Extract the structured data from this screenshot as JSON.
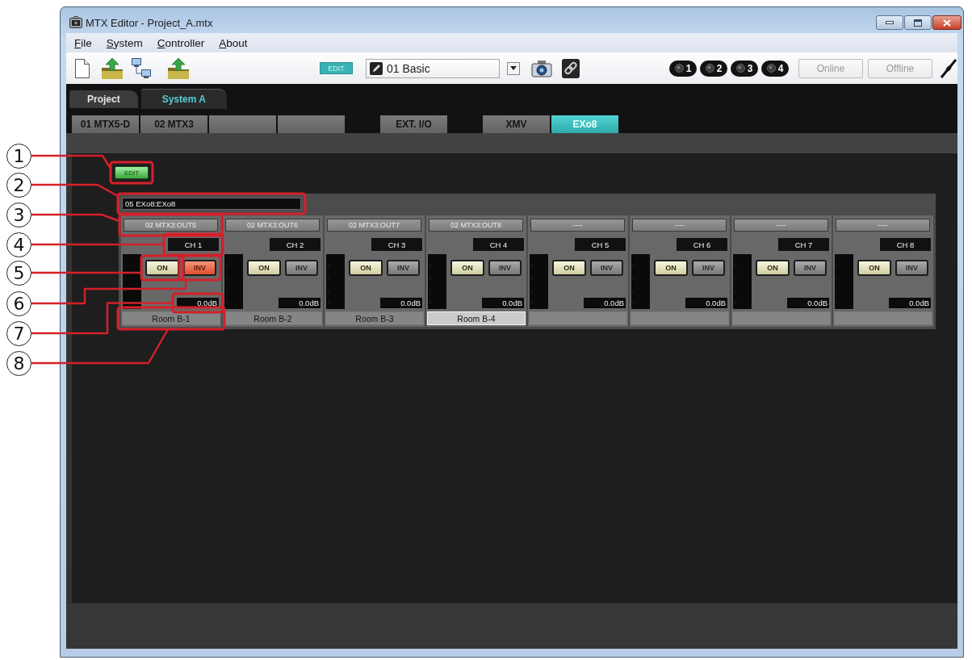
{
  "window": {
    "title": "MTX Editor - Project_A.mtx"
  },
  "menu": [
    "File",
    "System",
    "Controller",
    "About"
  ],
  "toolbar": {
    "mode": "EDIT",
    "preset": "01 Basic",
    "units": [
      "1",
      "2",
      "3",
      "4"
    ],
    "buttons": [
      {
        "label": "Online",
        "disabled": true
      },
      {
        "label": "Offline",
        "disabled": true
      }
    ]
  },
  "tabs": [
    {
      "label": "Project",
      "selected": false
    },
    {
      "label": "System A",
      "selected": true
    }
  ],
  "device_groups": [
    [
      {
        "label": "01 MTX5-D",
        "selected": false
      },
      {
        "label": "02 MTX3",
        "selected": false
      },
      {
        "selected": false
      },
      {
        "selected": false
      }
    ],
    [
      {
        "label": "EXT. I/O",
        "selected": false
      }
    ],
    [
      {
        "label": "XMV",
        "selected": false
      },
      {
        "label": "EXo8",
        "selected": true
      }
    ]
  ],
  "edit_button": "EDIT",
  "device_name": "05 EXo8:EXo8",
  "channels": [
    {
      "source": "02 MTX3:OUT5",
      "name": "CH 1",
      "on_button": {
        "label": "ON",
        "on": true
      },
      "inv_button": {
        "label": "INV",
        "on": true
      },
      "reading": "0.0dB",
      "room": "Room B-1",
      "room_selected": false
    },
    {
      "source": "02 MTX3:OUT6",
      "name": "CH 2",
      "on_button": {
        "label": "ON",
        "on": true
      },
      "inv_button": {
        "label": "INV",
        "on": false
      },
      "reading": "0.0dB",
      "room": "Room B-2",
      "room_selected": false
    },
    {
      "source": "02 MTX3:OUT7",
      "name": "CH 3",
      "on_button": {
        "label": "ON",
        "on": true
      },
      "inv_button": {
        "label": "INV",
        "on": false
      },
      "reading": "0.0dB",
      "room": "Room B-3",
      "room_selected": false
    },
    {
      "source": "02 MTX3:OUT8",
      "name": "CH 4",
      "on_button": {
        "label": "ON",
        "on": true
      },
      "inv_button": {
        "label": "INV",
        "on": false
      },
      "reading": "0.0dB",
      "room": "Room B-4",
      "room_selected": true
    },
    {
      "source": "----",
      "name": "CH 5",
      "on_button": {
        "label": "ON",
        "on": true
      },
      "inv_button": {
        "label": "INV",
        "on": false
      },
      "reading": "0.0dB",
      "room_selected": false
    },
    {
      "source": "----",
      "name": "CH 6",
      "on_button": {
        "label": "ON",
        "on": true
      },
      "inv_button": {
        "label": "INV",
        "on": false
      },
      "reading": "0.0dB",
      "room_selected": false
    },
    {
      "source": "----",
      "name": "CH 7",
      "on_button": {
        "label": "ON",
        "on": true
      },
      "inv_button": {
        "label": "INV",
        "on": false
      },
      "reading": "0.0dB",
      "room_selected": false
    },
    {
      "source": "----",
      "name": "CH 8",
      "on_button": {
        "label": "ON",
        "on": true
      },
      "inv_button": {
        "label": "INV",
        "on": false
      },
      "reading": "0.0dB",
      "room_selected": false
    }
  ],
  "callouts": [
    "1",
    "2",
    "3",
    "4",
    "5",
    "6",
    "7",
    "8"
  ]
}
